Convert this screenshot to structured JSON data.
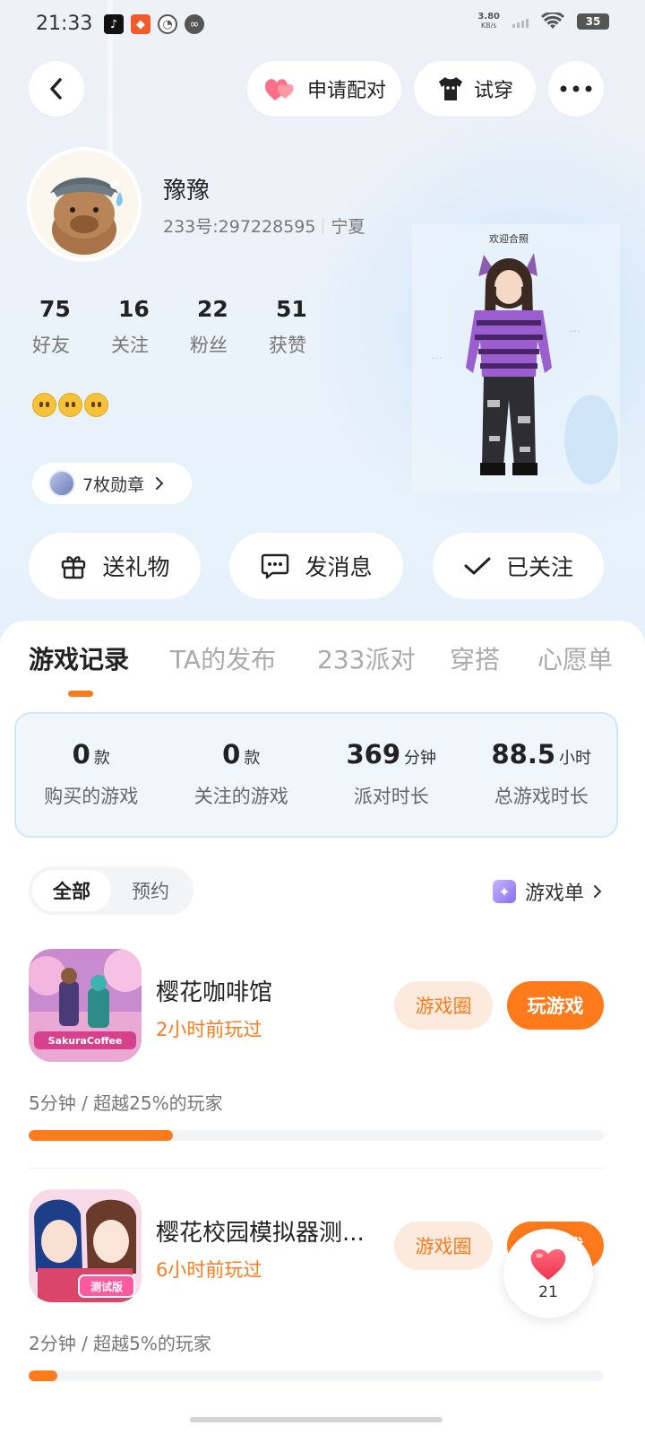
{
  "status_bar": {
    "time": "21:33",
    "net_speed_value": "3.80",
    "net_speed_unit": "KB/s",
    "battery": "35"
  },
  "header": {
    "match_label": "申请配对",
    "tryon_label": "试穿"
  },
  "profile": {
    "name": "豫豫",
    "uid": "233号:297228595",
    "region": "宁夏",
    "stats": [
      {
        "value": "75",
        "label": "好友"
      },
      {
        "value": "16",
        "label": "关注"
      },
      {
        "value": "22",
        "label": "粉丝"
      },
      {
        "value": "51",
        "label": "获赞"
      }
    ],
    "medals_label": "7枚勋章",
    "character_banner": "欢迎合照"
  },
  "actions": {
    "gift": "送礼物",
    "message": "发消息",
    "follow": "已关注"
  },
  "tabs": [
    "游戏记录",
    "TA的发布",
    "233派对",
    "穿搭",
    "心愿单"
  ],
  "summary": [
    {
      "value": "0",
      "unit": "款",
      "label": "购买的游戏"
    },
    {
      "value": "0",
      "unit": "款",
      "label": "关注的游戏"
    },
    {
      "value": "369",
      "unit": "分钟",
      "label": "派对时长"
    },
    {
      "value": "88.5",
      "unit": "小时",
      "label": "总游戏时长"
    }
  ],
  "filter": {
    "all": "全部",
    "reserved": "预约",
    "game_list": "游戏单"
  },
  "games": [
    {
      "title": "樱花咖啡馆",
      "last_played": "2小时前玩过",
      "stats": "5分钟 / 超越25%的玩家",
      "progress": 0.25,
      "circle_label": "游戏圈",
      "play_label": "玩游戏",
      "icon_text": "SakuraCoffee"
    },
    {
      "title": "樱花校园模拟器测...",
      "last_played": "6小时前玩过",
      "stats": "2分钟 / 超越5%的玩家",
      "progress": 0.05,
      "circle_label": "游戏圈",
      "play_label": "玩游戏",
      "icon_text": "测试版"
    }
  ],
  "like": {
    "count": "21"
  },
  "colors": {
    "accent": "#ff7a1a",
    "accent_light": "#fdeadf",
    "summary_bg": "#eff7fc"
  }
}
